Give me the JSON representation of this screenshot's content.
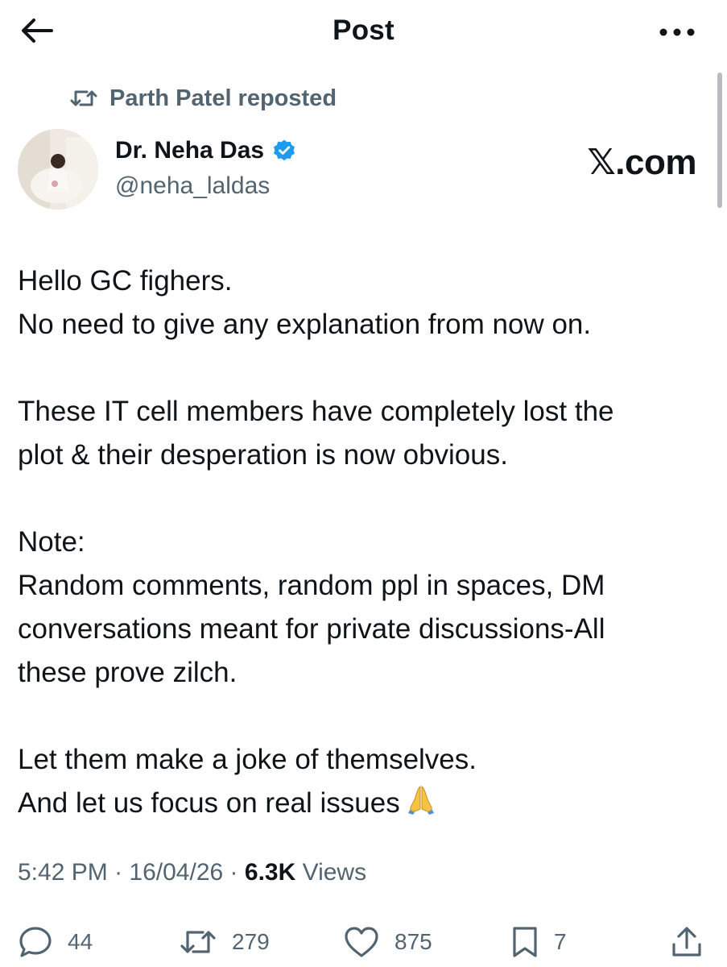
{
  "header": {
    "title": "Post"
  },
  "repost": {
    "label": "Parth Patel reposted"
  },
  "author": {
    "name": "Dr. Neha Das",
    "handle": "@neha_laldas",
    "verified": true
  },
  "brand": "𝕏.com",
  "post": {
    "lines": [
      "Hello GC fighers.",
      "No need to give any explanation from now on.",
      "",
      "These IT cell members have completely lost the",
      "plot & their desperation is now obvious.",
      "",
      "Note:",
      "Random comments, random ppl in spaces, DM",
      "conversations meant for private discussions-All",
      "these prove zilch.",
      "",
      "Let them make a joke of themselves.",
      "And let us focus on real issues"
    ],
    "trailing_emoji": "🙏"
  },
  "meta": {
    "time": "5:42 PM",
    "date": "16/04/26",
    "views_count": "6.3K",
    "views_label": "Views",
    "separator": "·"
  },
  "actions": {
    "replies": "44",
    "reposts": "279",
    "likes": "875",
    "bookmarks": "7"
  },
  "colors": {
    "text": "#0f1419",
    "secondary": "#536471",
    "verified": "#1d9bf0"
  }
}
